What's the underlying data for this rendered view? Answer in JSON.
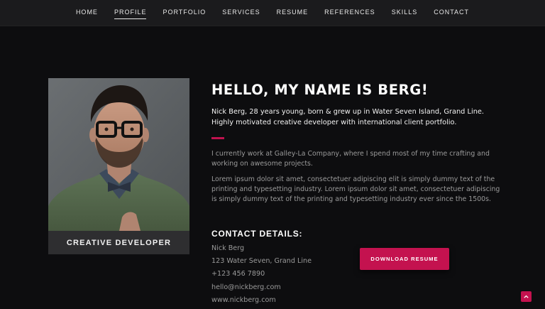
{
  "nav": {
    "items": [
      {
        "label": "HOME",
        "active": false
      },
      {
        "label": "PROFILE",
        "active": true
      },
      {
        "label": "PORTFOLIO",
        "active": false
      },
      {
        "label": "SERVICES",
        "active": false
      },
      {
        "label": "RESUME",
        "active": false
      },
      {
        "label": "REFERENCES",
        "active": false
      },
      {
        "label": "SKILLS",
        "active": false
      },
      {
        "label": "CONTACT",
        "active": false
      }
    ]
  },
  "profile": {
    "caption": "CREATIVE DEVELOPER",
    "headline": "HELLO, MY NAME IS BERG!",
    "lead": "Nick Berg, 28 years young, born & grew up in Water Seven Island, Grand Line. Highly motivated creative developer with international client portfolio.",
    "paragraphs": [
      "I currently work at Galley-La Company, where I spend most of my time crafting and working on awesome projects.",
      "Lorem ipsum dolor sit amet, consectetuer adipiscing elit is simply dummy text of the printing and typesetting industry. Lorem ipsum dolor sit amet, consectetuer adipiscing is simply dummy text of the printing and typesetting industry ever since the 1500s."
    ]
  },
  "contact": {
    "title": "CONTACT DETAILS:",
    "name": "Nick Berg",
    "address": "123 Water Seven, Grand Line",
    "phone": "+123 456 7890",
    "email": "hello@nickberg.com",
    "website": "www.nickberg.com"
  },
  "actions": {
    "download_label": "DOWNLOAD RESUME",
    "back_to_top_icon": "chevron-up-icon"
  },
  "colors": {
    "accent": "#c4124f",
    "background": "#0d0d0f",
    "navbar": "#1b1b1d"
  }
}
